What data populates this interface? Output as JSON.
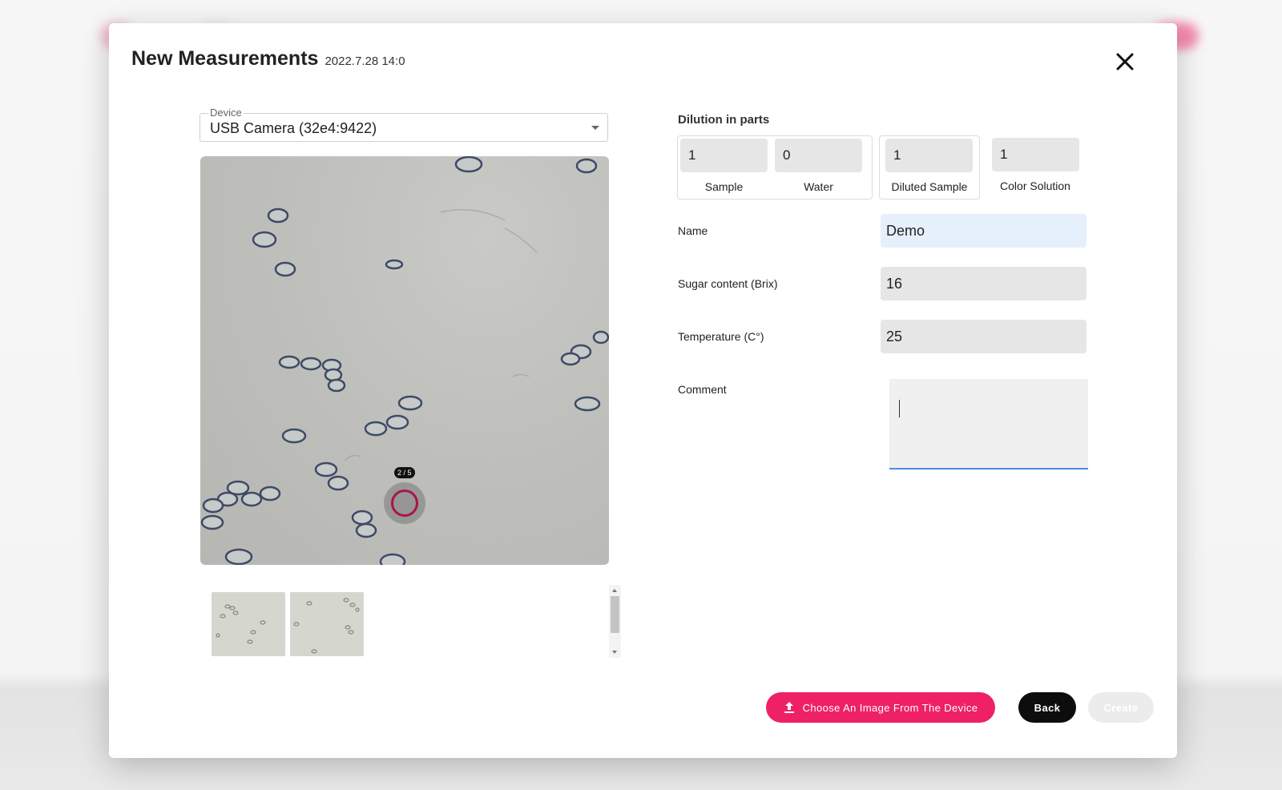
{
  "dialog": {
    "title": "New Measurements",
    "date": "2022.7.28 14:0"
  },
  "device": {
    "label": "Device",
    "value": "USB Camera (32e4:9422)"
  },
  "camera": {
    "shot_counter": "2 / 5"
  },
  "dilution": {
    "title": "Dilution in parts",
    "sample": {
      "value": "1",
      "caption": "Sample"
    },
    "water": {
      "value": "0",
      "caption": "Water"
    },
    "diluted_sample": {
      "value": "1",
      "caption": "Diluted Sample"
    },
    "color_solution": {
      "value": "1",
      "caption": "Color Solution"
    }
  },
  "form": {
    "name": {
      "label": "Name",
      "value": "Demo"
    },
    "sugar": {
      "label": "Sugar content (Brix)",
      "value": "16"
    },
    "temperature": {
      "label": "Temperature (C°)",
      "value": "25"
    },
    "comment": {
      "label": "Comment",
      "value": ""
    }
  },
  "buttons": {
    "upload": "Choose An Image From The Device",
    "back": "Back",
    "create": "Create"
  },
  "colors": {
    "accent": "#ee2167",
    "shutter_ring": "#a8154a",
    "focus_underline": "#4a8fe0"
  },
  "icons": [
    "close-icon",
    "dropdown-caret-icon",
    "upload-icon",
    "shutter-icon"
  ]
}
